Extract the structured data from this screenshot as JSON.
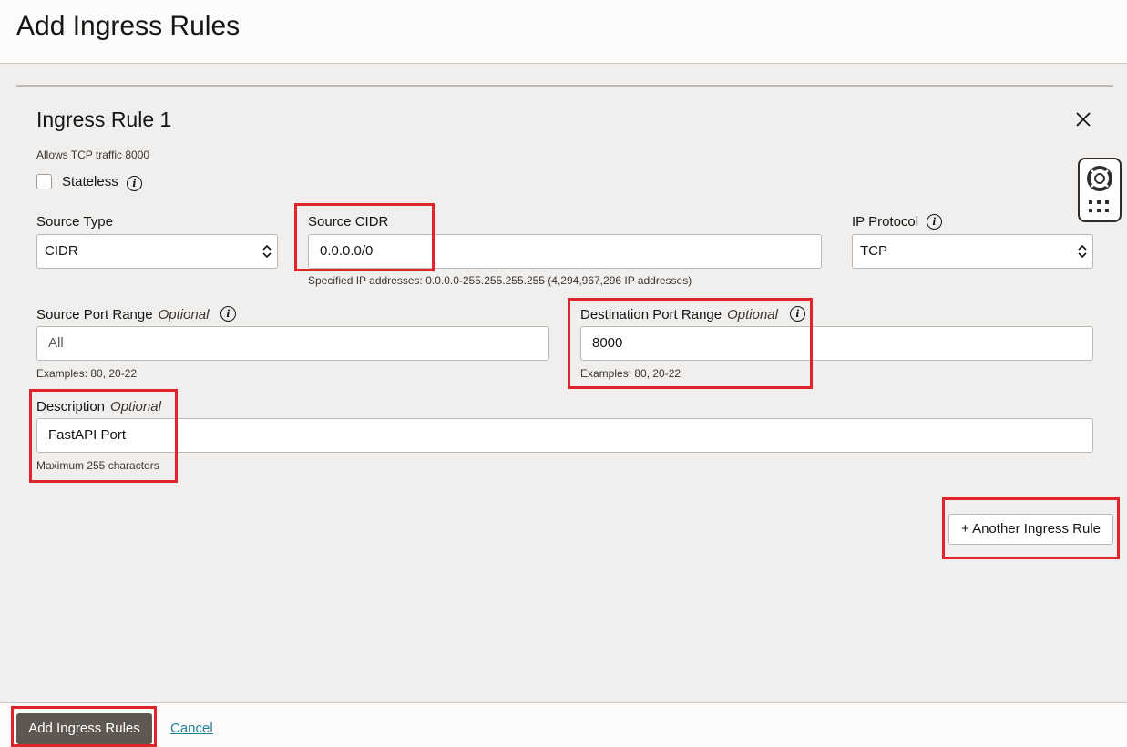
{
  "header": {
    "title": "Add Ingress Rules"
  },
  "rule": {
    "title": "Ingress Rule 1",
    "description": "Allows TCP traffic 8000",
    "stateless_label": "Stateless",
    "stateless_checked": false
  },
  "fields": {
    "source_type": {
      "label": "Source Type",
      "value": "CIDR"
    },
    "source_cidr": {
      "label": "Source CIDR",
      "value": "0.0.0.0/0",
      "hint": "Specified IP addresses: 0.0.0.0-255.255.255.255 (4,294,967,296 IP addresses)"
    },
    "ip_protocol": {
      "label": "IP Protocol",
      "value": "TCP"
    },
    "source_port_range": {
      "label": "Source Port Range",
      "optional": "Optional",
      "placeholder": "All",
      "hint": "Examples: 80, 20-22"
    },
    "destination_port_range": {
      "label": "Destination Port Range",
      "optional": "Optional",
      "value": "8000",
      "hint": "Examples: 80, 20-22"
    },
    "description": {
      "label": "Description",
      "optional": "Optional",
      "value": "FastAPI Port",
      "hint": "Maximum 255 characters"
    }
  },
  "actions": {
    "another_rule": "+ Another Ingress Rule",
    "submit": "Add Ingress Rules",
    "cancel": "Cancel"
  },
  "colors": {
    "highlight": "#e0242b",
    "primary_button": "#5f5751",
    "link": "#227e9e"
  },
  "icons": {
    "close": "close-icon",
    "info": "info-icon",
    "chevron": "chevron-updown-icon",
    "help": "lifebuoy-icon",
    "apps": "grid-icon"
  }
}
